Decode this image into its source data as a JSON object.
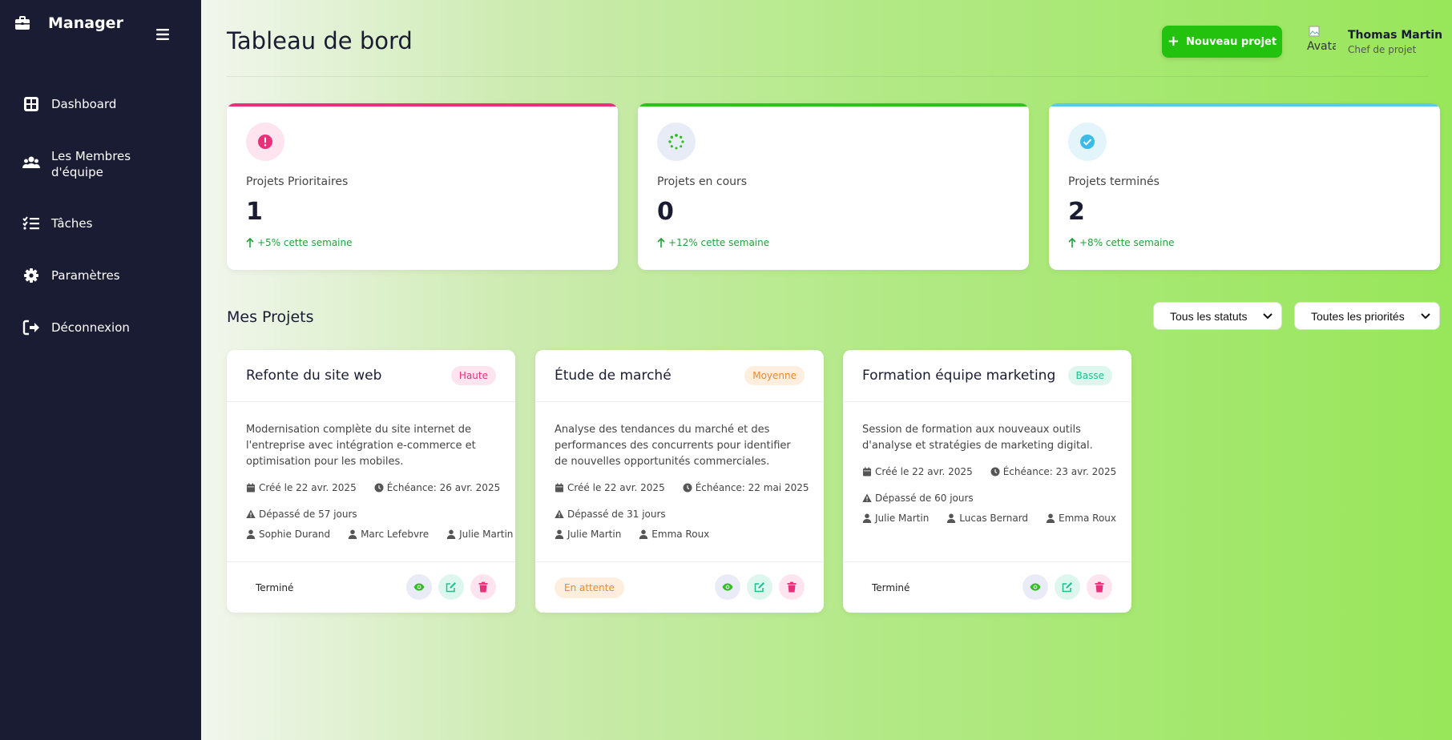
{
  "sidebar": {
    "brand": "Manager",
    "items": [
      {
        "label": "Dashboard",
        "icon": "grid-icon"
      },
      {
        "label": "Les Membres d'équipe",
        "icon": "users-icon"
      },
      {
        "label": "Tâches",
        "icon": "tasks-icon"
      },
      {
        "label": "Paramètres",
        "icon": "gear-icon"
      },
      {
        "label": "Déconnexion",
        "icon": "logout-icon"
      }
    ]
  },
  "header": {
    "title": "Tableau de bord",
    "new_button": "Nouveau projet",
    "avatar_alt": "Avatar",
    "user_name": "Thomas Martin",
    "user_role": "Chef de projet"
  },
  "stats": [
    {
      "label": "Projets Prioritaires",
      "value": "1",
      "trend": "+5% cette semaine",
      "accent": "#e8317a",
      "icon": "exclamation-icon"
    },
    {
      "label": "Projets en cours",
      "value": "0",
      "trend": "+12% cette semaine",
      "accent": "#2fbf1f",
      "icon": "spinner-icon"
    },
    {
      "label": "Projets terminés",
      "value": "2",
      "trend": "+8% cette semaine",
      "accent": "#5bc8ea",
      "icon": "check-circle-icon"
    }
  ],
  "projects_section": {
    "title": "Mes Projets",
    "status_filter": "Tous les statuts",
    "priority_filter": "Toutes les priorités"
  },
  "projects": [
    {
      "title": "Refonte du site web",
      "priority": "Haute",
      "description": "Modernisation complète du site internet de l'entreprise avec intégration e-commerce et optimisation pour les mobiles.",
      "created": "Créé le 22 avr. 2025",
      "due": "Échéance: 26 avr. 2025",
      "overdue": "Dépassé de 57 jours",
      "members": [
        "Sophie Durand",
        "Marc Lefebvre",
        "Julie Martin"
      ],
      "status": "Terminé"
    },
    {
      "title": "Étude de marché",
      "priority": "Moyenne",
      "description": "Analyse des tendances du marché et des performances des concurrents pour identifier de nouvelles opportunités commerciales.",
      "created": "Créé le 22 avr. 2025",
      "due": "Échéance: 22 mai 2025",
      "overdue": "Dépassé de 31 jours",
      "members": [
        "Julie Martin",
        "Emma Roux"
      ],
      "status": "En attente"
    },
    {
      "title": "Formation équipe marketing",
      "priority": "Basse",
      "description": "Session de formation aux nouveaux outils d'analyse et stratégies de marketing digital.",
      "created": "Créé le 22 avr. 2025",
      "due": "Échéance: 23 avr. 2025",
      "overdue": "Dépassé de 60 jours",
      "members": [
        "Julie Martin",
        "Lucas Bernard",
        "Emma Roux"
      ],
      "status": "Terminé"
    }
  ],
  "colors": {
    "sidebar_bg": "#1a1c33",
    "primary_green": "#22c20f",
    "priority_high": "#e8317a",
    "priority_medium": "#f08a24",
    "priority_low": "#1fbf8f"
  }
}
